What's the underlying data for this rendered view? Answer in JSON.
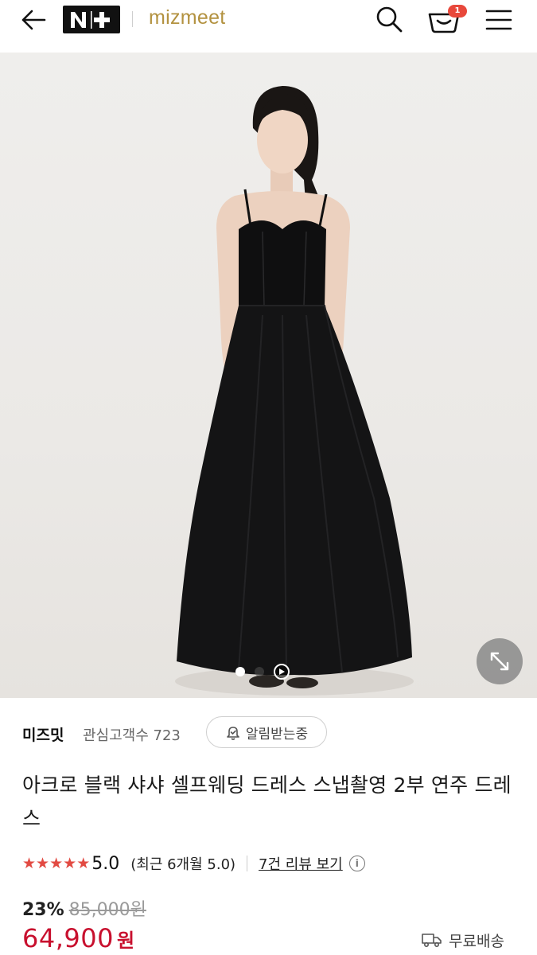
{
  "header": {
    "back_icon": "arrow-left-icon",
    "platform_logo": "N+",
    "brand_logo": "mizmeet",
    "search_icon": "search-icon",
    "cart_icon": "cart-icon",
    "cart_count": "1",
    "menu_icon": "hamburger-menu-icon"
  },
  "gallery": {
    "expand_icon": "expand-arrows-icon",
    "play_icon": "play-icon",
    "slide_count": 2,
    "active_slide": 1
  },
  "seller": {
    "name": "미즈밋",
    "followers_label": "관심고객수 723",
    "alert_label": "알림받는중"
  },
  "product": {
    "title": "아크로 블랙 샤샤 셀프웨딩 드레스 스냅촬영 2부 연주 드레스"
  },
  "rating": {
    "stars": 5,
    "score": "5.0",
    "recent": "(최근 6개월 5.0)",
    "review_link": "7건 리뷰 보기",
    "info_icon": "i"
  },
  "price": {
    "discount_rate": "23%",
    "original_price": "85,000원",
    "sale_price": "64,900",
    "unit": "원"
  },
  "shipping": {
    "label": "무료배송",
    "icon": "truck-icon"
  },
  "colors": {
    "accent_red": "#c8102e",
    "star_red": "#e24a42",
    "brand_gold": "#b39240",
    "badge_red": "#e8483b"
  }
}
